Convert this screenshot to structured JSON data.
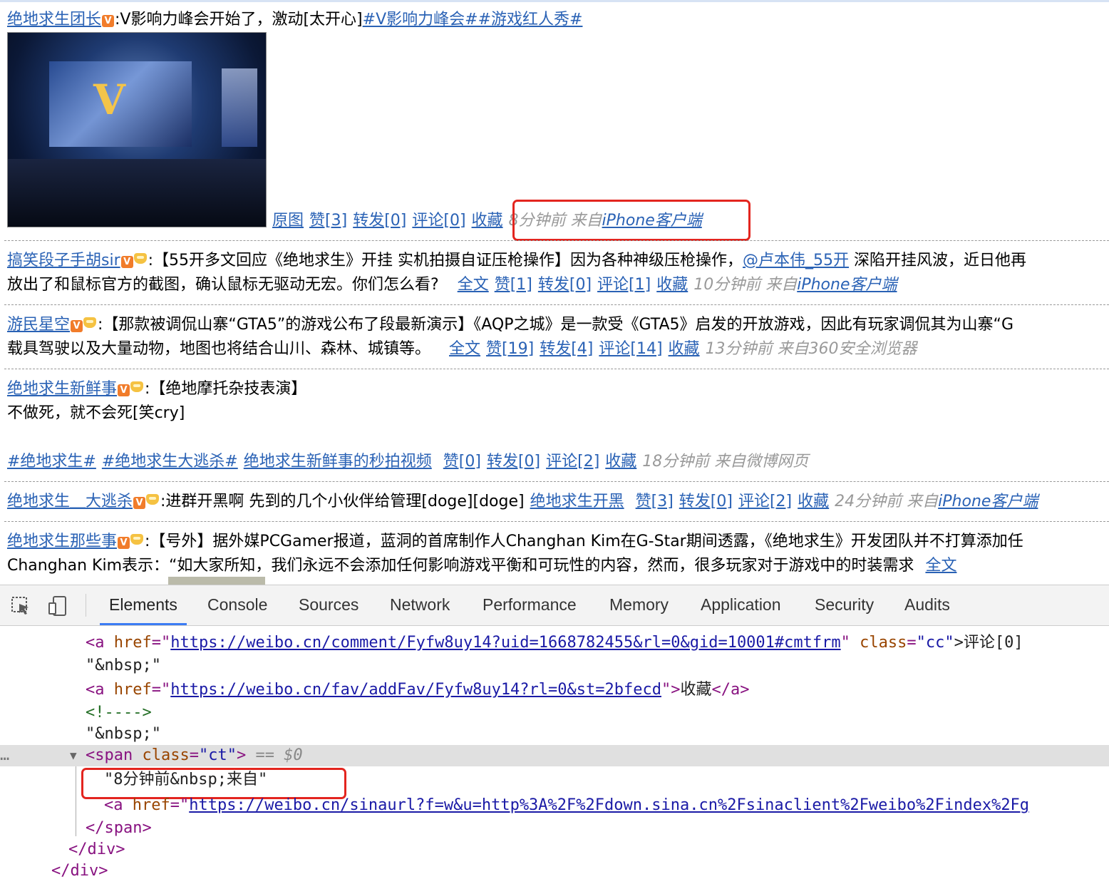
{
  "posts": [
    {
      "author": "绝地求生团长",
      "badge": "V",
      "text": ":V影响力峰会开始了，激动[太开心]",
      "topic": "#V影响力峰会##游戏红人秀#",
      "actions": [
        "原图",
        "赞[3]",
        "转发[0]",
        "评论[0]",
        "收藏"
      ],
      "time": "8分钟前 来自",
      "source": "iPhone客户端"
    },
    {
      "author": "搞笑段子手胡sir",
      "line1": ":【55开多文回应《绝地求生》开挂 实机拍摄自证压枪操作】因为各种神级压枪操作，",
      "mention": "@卢本伟_55开",
      "line1b": " 深陷开挂风波，近日他再",
      "line2": "放出了和鼠标官方的截图，确认鼠标无驱动无宏。你们怎么看?",
      "actions": [
        "全文",
        "赞[1]",
        "转发[0]",
        "评论[1]",
        "收藏"
      ],
      "time": "10分钟前 来自",
      "source": "iPhone客户端"
    },
    {
      "author": "游民星空",
      "line1": ":【那款被调侃山寨“GTA5”的游戏公布了段最新演示】《AQP之城》是一款受《GTA5》启发的开放游戏，因此有玩家调侃其为山寨“G",
      "line2": "载具驾驶以及大量动物，地图也将结合山川、森林、城镇等。",
      "actions": [
        "全文",
        "赞[19]",
        "转发[4]",
        "评论[14]",
        "收藏"
      ],
      "time": "13分钟前 来自360安全浏览器"
    },
    {
      "author": "绝地求生新鲜事",
      "line1": ":【绝地摩托杂技表演】",
      "line2": "不做死，就不会死[笑cry]",
      "topics": [
        "#绝地求生#",
        "#绝地求生大逃杀#",
        "绝地求生新鲜事的秒拍视频"
      ],
      "actions": [
        "赞[0]",
        "转发[0]",
        "评论[2]",
        "收藏"
      ],
      "time": "18分钟前 来自微博网页"
    },
    {
      "author": "绝地求生＿大逃杀",
      "line1": ":进群开黑啊 先到的几个小伙伴给管理[doge][doge]",
      "link": "绝地求生开黑",
      "actions": [
        "赞[3]",
        "转发[0]",
        "评论[2]",
        "收藏"
      ],
      "time": "24分钟前 来自",
      "source": "iPhone客户端"
    },
    {
      "author": "绝地求生那些事",
      "line1": ":【号外】据外媒PCGamer报道，蓝洞的首席制作人Changhan Kim在G-Star期间透露，《绝地求生》开发团队并不打算添加任",
      "line2": "Changhan Kim表示：“如大家所知，我们永远不会添加任何影响游戏平衡和可玩性的内容，然而，很多玩家对于游戏中的时装需求",
      "more": "全文"
    }
  ],
  "devtools": {
    "tabs": [
      "Elements",
      "Console",
      "Sources",
      "Network",
      "Performance",
      "Memory",
      "Application",
      "Security",
      "Audits"
    ],
    "active_tab": "Elements",
    "lines": {
      "l1_tag": "<a",
      "l1_attr": "href",
      "l1_url": "https://weibo.cn/comment/Fyfw8uy14?uid=1668782455&rl=0&gid=10001#cmtfrm",
      "l1_attr2": "class",
      "l1_val2": "\"cc\"",
      "l1_text": ">评论[0]",
      "l2": "\"&nbsp;\"",
      "l3_url": "https://weibo.cn/fav/addFav/Fyfw8uy14?rl=0&st=2bfecd",
      "l3_text": "收藏",
      "l3_close": "</a>",
      "l4": "<!---->",
      "l5": "\"&nbsp;\"",
      "l6_tag": "<span",
      "l6_attr": "class",
      "l6_val": "\"ct\"",
      "l6_eq": "== $0",
      "l7": "\"8分钟前&nbsp;来自\"",
      "l8_url": "https://weibo.cn/sinaurl?f=w&u=http%3A%2F%2Fdown.sina.cn%2Fsinaclient%2Fweibo%2Findex%2Fg",
      "l9": "</span>",
      "l10": "</div>",
      "l11": "</div>"
    }
  },
  "colors": {
    "link": "#2a62b5",
    "highlight_box": "#e3251f",
    "active_tab": "#3b7cf4"
  }
}
